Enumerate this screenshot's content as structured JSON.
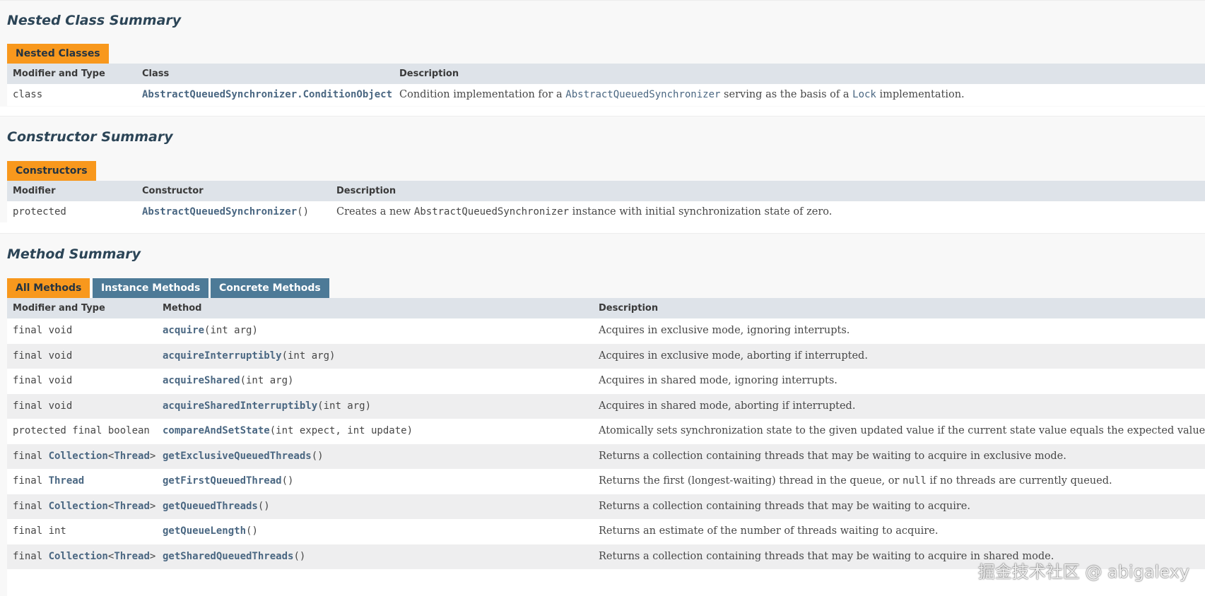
{
  "nested": {
    "title": "Nested Class Summary",
    "tab": "Nested Classes",
    "headers": [
      "Modifier and Type",
      "Class",
      "Description"
    ],
    "row": {
      "modifier": "class",
      "class_name": "AbstractQueuedSynchronizer.ConditionObject",
      "desc_part1": "Condition implementation for a ",
      "desc_code1": "AbstractQueuedSynchronizer",
      "desc_part2": " serving as the basis of a ",
      "desc_code2": "Lock",
      "desc_part3": " implementation."
    }
  },
  "constructors": {
    "title": "Constructor Summary",
    "tab": "Constructors",
    "headers": [
      "Modifier",
      "Constructor",
      "Description"
    ],
    "row": {
      "modifier": "protected",
      "name": "AbstractQueuedSynchronizer",
      "params": "()",
      "desc_part1": "Creates a new ",
      "desc_code": "AbstractQueuedSynchronizer",
      "desc_part2": " instance with initial synchronization state of zero."
    }
  },
  "methods": {
    "title": "Method Summary",
    "tabs": [
      "All Methods",
      "Instance Methods",
      "Concrete Methods"
    ],
    "headers": [
      "Modifier and Type",
      "Method",
      "Description"
    ],
    "rows": [
      {
        "mod_pre": "final void",
        "mod_link": "",
        "mod_mid": "",
        "mod_link2": "",
        "mod_post": "",
        "name": "acquire",
        "params": "(int arg)",
        "desc": "Acquires in exclusive mode, ignoring interrupts."
      },
      {
        "mod_pre": "final void",
        "mod_link": "",
        "mod_mid": "",
        "mod_link2": "",
        "mod_post": "",
        "name": "acquireInterruptibly",
        "params": "(int arg)",
        "desc": "Acquires in exclusive mode, aborting if interrupted."
      },
      {
        "mod_pre": "final void",
        "mod_link": "",
        "mod_mid": "",
        "mod_link2": "",
        "mod_post": "",
        "name": "acquireShared",
        "params": "(int arg)",
        "desc": "Acquires in shared mode, ignoring interrupts."
      },
      {
        "mod_pre": "final void",
        "mod_link": "",
        "mod_mid": "",
        "mod_link2": "",
        "mod_post": "",
        "name": "acquireSharedInterruptibly",
        "params": "(int arg)",
        "desc": "Acquires in shared mode, aborting if interrupted."
      },
      {
        "mod_pre": "protected final boolean",
        "mod_link": "",
        "mod_mid": "",
        "mod_link2": "",
        "mod_post": "",
        "name": "compareAndSetState",
        "params": "(int expect, int update)",
        "desc": "Atomically sets synchronization state to the given updated value if the current state value equals the expected value."
      },
      {
        "mod_pre": "final ",
        "mod_link": "Collection",
        "mod_mid": "<",
        "mod_link2": "Thread",
        "mod_post": ">",
        "name": "getExclusiveQueuedThreads",
        "params": "()",
        "desc": "Returns a collection containing threads that may be waiting to acquire in exclusive mode."
      },
      {
        "mod_pre": "final ",
        "mod_link": "Thread",
        "mod_mid": "",
        "mod_link2": "",
        "mod_post": "",
        "name": "getFirstQueuedThread",
        "params": "()",
        "desc": "Returns the first (longest-waiting) thread in the queue, or ",
        "desc_code": "null",
        "desc_tail": " if no threads are currently queued."
      },
      {
        "mod_pre": "final ",
        "mod_link": "Collection",
        "mod_mid": "<",
        "mod_link2": "Thread",
        "mod_post": ">",
        "name": "getQueuedThreads",
        "params": "()",
        "desc": "Returns a collection containing threads that may be waiting to acquire."
      },
      {
        "mod_pre": "final int",
        "mod_link": "",
        "mod_mid": "",
        "mod_link2": "",
        "mod_post": "",
        "name": "getQueueLength",
        "params": "()",
        "desc": "Returns an estimate of the number of threads waiting to acquire."
      },
      {
        "mod_pre": "final ",
        "mod_link": "Collection",
        "mod_mid": "<",
        "mod_link2": "Thread",
        "mod_post": ">",
        "name": "getSharedQueuedThreads",
        "params": "()",
        "desc": "Returns a collection containing threads that may be waiting to acquire in shared mode."
      }
    ]
  },
  "watermark": "掘金技术社区 @ abigalexy",
  "colors": {
    "tab_active": "#f8981d",
    "tab_inactive": "#4d7a97",
    "header_bg": "#dee3e9",
    "link": "#4a6782",
    "row_alt": "#eeeeef"
  }
}
